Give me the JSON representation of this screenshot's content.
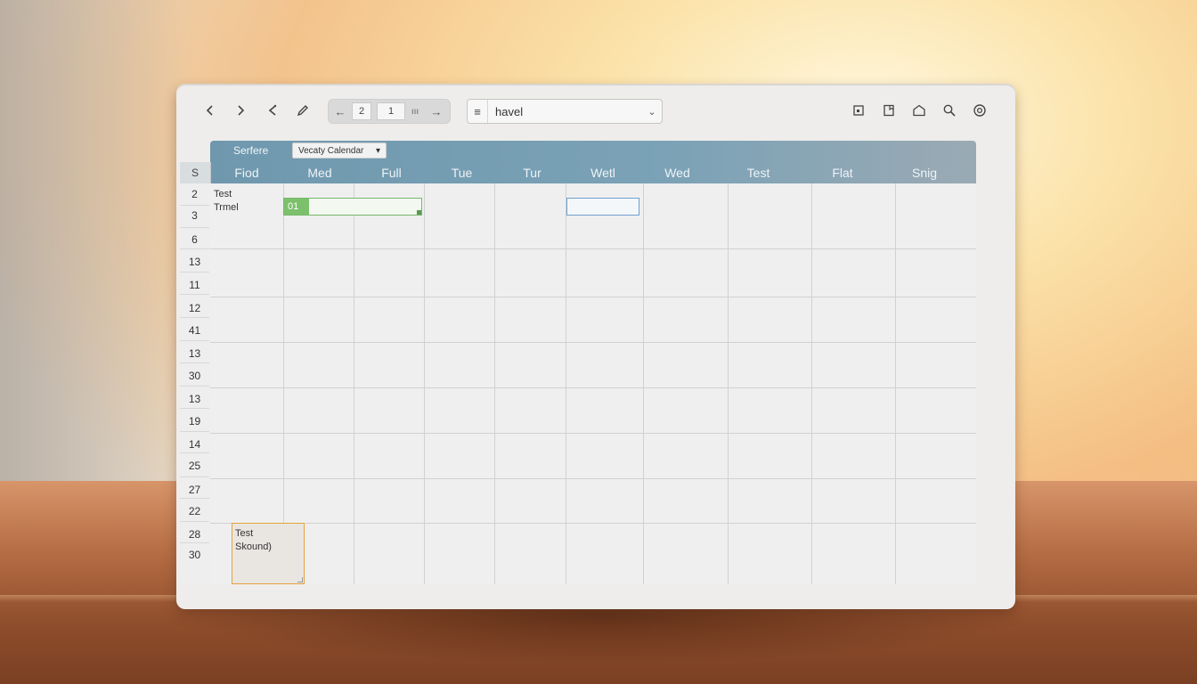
{
  "toolbar": {
    "back_icon": "chevron-left-icon",
    "forward_icon": "chevron-right-icon",
    "share_icon": "share-icon",
    "edit_icon": "pencil-icon",
    "pager": {
      "left_arrow": "←",
      "value_a": "2",
      "value_b": "1",
      "label": "ııı",
      "right_arrow": "→"
    },
    "view_select": {
      "menu_icon": "≡",
      "value": "havel",
      "chevron": "⌄"
    },
    "right_icons": [
      "calendar-icon",
      "bookmark-icon",
      "home-icon",
      "search-icon",
      "settings-icon"
    ]
  },
  "calendar": {
    "section_label": "Serfere",
    "calendar_select": "Vecaty Calendar",
    "corner_label": "S",
    "days": [
      "Fiod",
      "Med",
      "Full",
      "Tue",
      "Tur",
      "Wetl",
      "Wed",
      "Test",
      "Flat",
      "Snig"
    ],
    "row_numbers": [
      "2",
      "3",
      "6",
      "13",
      "11",
      "12",
      "41",
      "13",
      "30",
      "13",
      "19",
      "14",
      "25",
      "27",
      "22",
      "28",
      "30"
    ],
    "events": {
      "first": {
        "line1": "Test",
        "line2": "Trmel"
      },
      "bar_label": "01",
      "last": {
        "line1": "Test",
        "line2": "Skound)"
      }
    }
  },
  "colors": {
    "header_band": "#7ba2b6",
    "event_green": "#7cc06b",
    "selection_blue": "#6f9fcf",
    "selection_orange": "#e5a23d"
  }
}
